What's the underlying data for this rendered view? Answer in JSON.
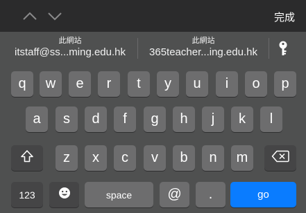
{
  "toolbar": {
    "prev_icon": "chevron-up-icon",
    "next_icon": "chevron-down-icon",
    "done_label": "完成"
  },
  "suggestions": [
    {
      "label": "此網站",
      "value": "itstaff@ss...ming.edu.hk"
    },
    {
      "label": "此網站",
      "value": "365teacher...ing.edu.hk"
    }
  ],
  "keychain_icon": "key-icon",
  "keyboard": {
    "row1": [
      "q",
      "w",
      "e",
      "r",
      "t",
      "y",
      "u",
      "i",
      "o",
      "p"
    ],
    "row2": [
      "a",
      "s",
      "d",
      "f",
      "g",
      "h",
      "j",
      "k",
      "l"
    ],
    "row3": [
      "z",
      "x",
      "c",
      "v",
      "b",
      "n",
      "m"
    ],
    "shift_icon": "shift-icon",
    "backspace_icon": "backspace-icon",
    "numbers_label": "123",
    "emoji_icon": "emoji-icon",
    "space_label": "space",
    "at_label": "@",
    "dot_label": ".",
    "go_label": "go"
  },
  "colors": {
    "toolbar_bg": "#2b2b2c",
    "keyboard_bg": "#4f5050",
    "letter_key": "#6d6d6e",
    "function_key": "#454546",
    "go_key": "#0a7cff"
  }
}
